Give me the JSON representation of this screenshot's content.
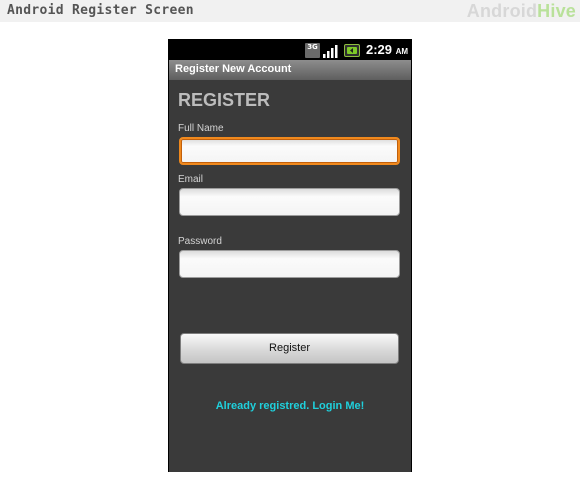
{
  "page": {
    "header_title": "Android Register Screen",
    "brand_part1": "Android",
    "brand_part2": "Hive",
    "brand_color_1": "#d7d7d7",
    "brand_color_2": "#b9e19a"
  },
  "statusbar": {
    "network_label": "3G",
    "time": "2:29",
    "ampm": "AM",
    "icons": [
      "3g-icon",
      "signal-icon",
      "battery-icon"
    ]
  },
  "app": {
    "title": "Register New Account",
    "heading": "REGISTER",
    "full_name_label": "Full Name",
    "full_name_value": "",
    "email_label": "Email",
    "email_value": "",
    "password_label": "Password",
    "password_value": "",
    "register_button": "Register",
    "login_link": "Already registred. Login Me!",
    "accent_focus_color": "#f0891d",
    "link_color": "#1fd0dc",
    "background_color": "#3a3a3a"
  }
}
